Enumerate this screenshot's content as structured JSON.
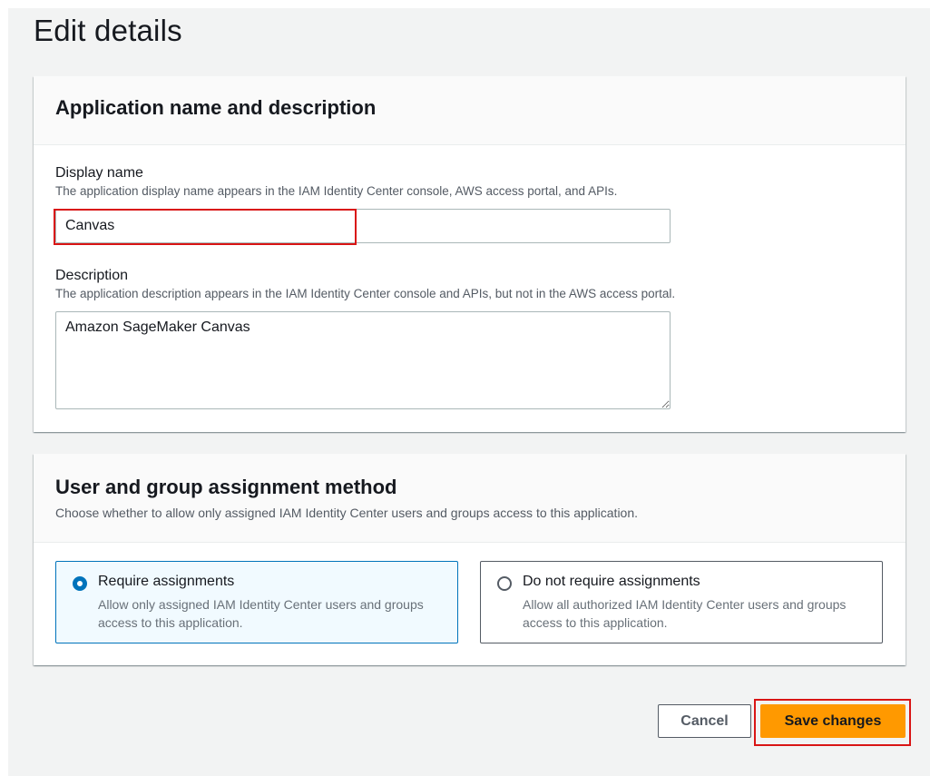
{
  "page": {
    "title": "Edit details"
  },
  "app_section": {
    "title": "Application name and description",
    "display_name": {
      "label": "Display name",
      "description": "The application display name appears in the IAM Identity Center console, AWS access portal, and APIs.",
      "value": "Canvas"
    },
    "description": {
      "label": "Description",
      "description": "The application description appears in the IAM Identity Center console and APIs, but not in the AWS access portal.",
      "value": "Amazon SageMaker Canvas"
    }
  },
  "assignment_section": {
    "title": "User and group assignment method",
    "description": "Choose whether to allow only assigned IAM Identity Center users and groups access to this application.",
    "options": [
      {
        "label": "Require assignments",
        "description": "Allow only assigned IAM Identity Center users and groups access to this application.",
        "selected": true
      },
      {
        "label": "Do not require assignments",
        "description": "Allow all authorized IAM Identity Center users and groups access to this application.",
        "selected": false
      }
    ]
  },
  "actions": {
    "cancel_label": "Cancel",
    "save_label": "Save changes"
  },
  "colors": {
    "accent": "#0073bb",
    "primary_button": "#ff9900",
    "highlight": "#d91515",
    "background": "#f2f3f3"
  }
}
